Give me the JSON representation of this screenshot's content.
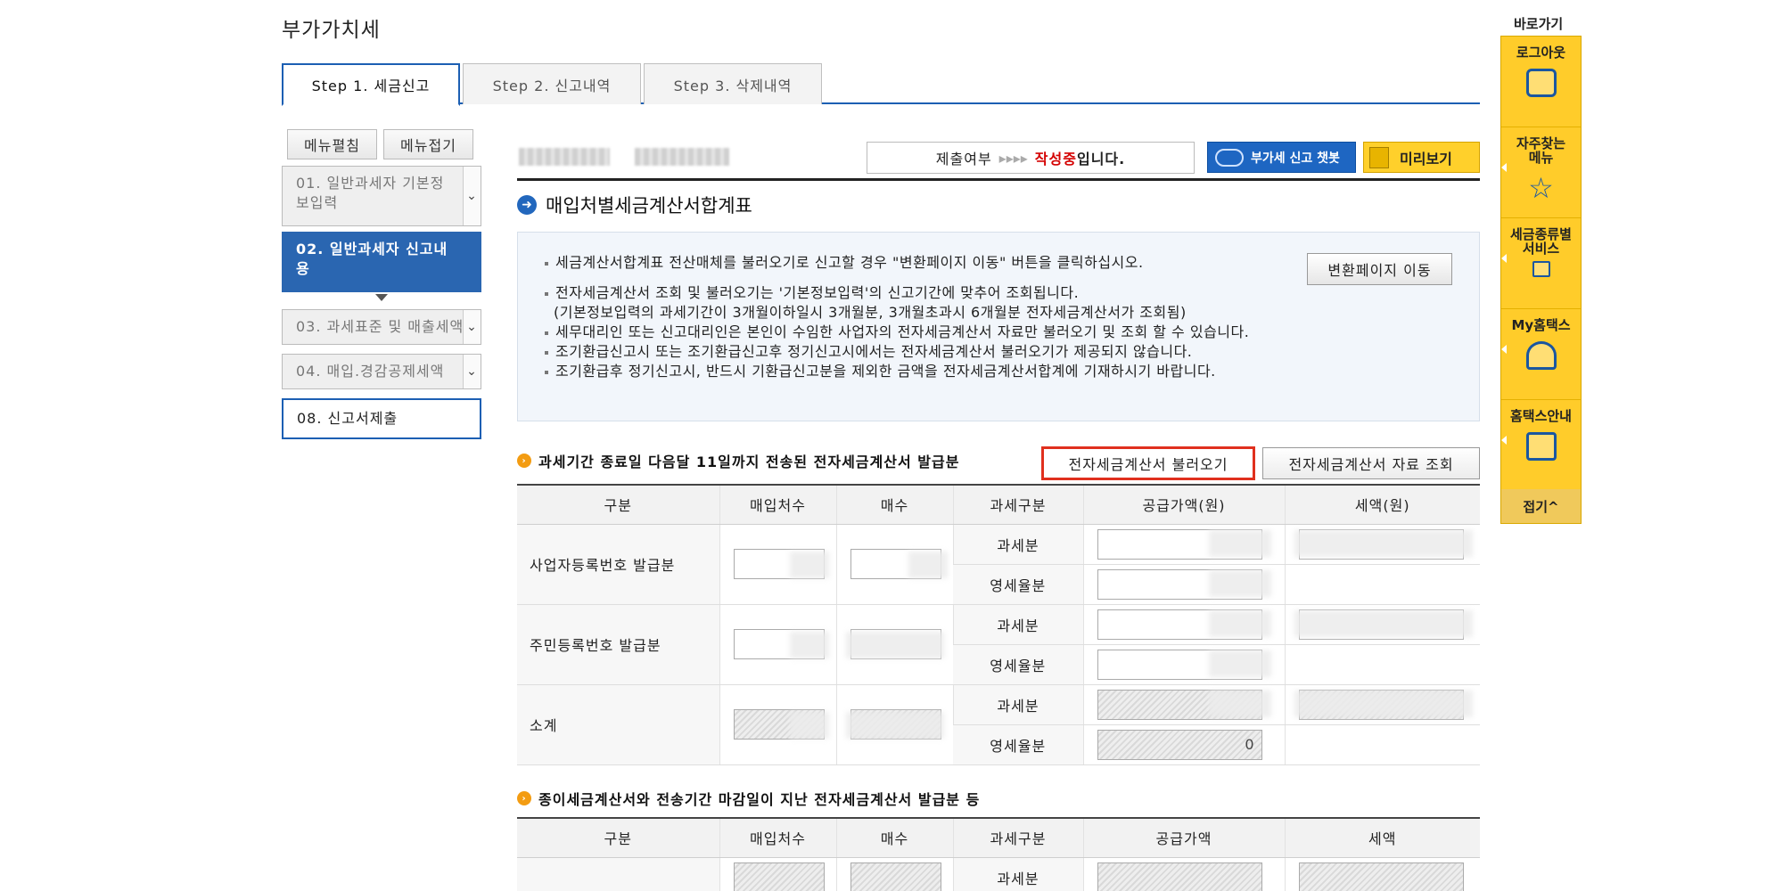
{
  "page_title": "부가가치세",
  "step_tabs": [
    "Step 1. 세금신고",
    "Step 2. 신고내역",
    "Step 3. 삭제내역"
  ],
  "menu_buttons": {
    "expand": "메뉴펼침",
    "collapse": "메뉴접기"
  },
  "left_menu": [
    {
      "label": "01. 일반과세자 기본정보입력"
    },
    {
      "label": "02. 일반과세자 신고내용"
    },
    {
      "label": "03. 과세표준 및 매출세액"
    },
    {
      "label": "04. 매입.경감공제세액"
    },
    {
      "label": "08. 신고서제출"
    }
  ],
  "status": {
    "prefix": "제출여부",
    "arrows": "▸▸▸▸",
    "highlight": "작성중",
    "suffix": "입니다."
  },
  "chatbot_label": "부가세 신고 챗봇",
  "preview_label": "미리보기",
  "section_title": "매입처별세금계산서합계표",
  "info_lines": [
    "세금계산서합계표 전산매체를 불러오기로 신고할 경우 \"변환페이지 이동\" 버튼을 클릭하십시오.",
    "전자세금계산서 조회 및 불러오기는 '기본정보입력'의 신고기간에 맞추어 조회됩니다.",
    "(기본정보입력의 과세기간이 3개월이하일시 3개월분, 3개월초과시 6개월분 전자세금계산서가 조회됨)",
    "세무대리인 또는 신고대리인은 본인이 수임한 사업자의 전자세금계산서 자료만 불러오기 및 조회 할 수 있습니다.",
    "조기환급신고시 또는 조기환급신고후 정기신고시에서는 전자세금계산서 불러오기가 제공되지 않습니다.",
    "조기환급후 정기신고시, 반드시 기환급신고분을 제외한 금액을 전자세금계산서합계에 기재하시기 바랍니다."
  ],
  "convert_button": "변환페이지 이동",
  "sub1_title": "과세기간 종료일 다음달 11일까지 전송된 전자세금계산서 발급분",
  "fetch_button": "전자세금계산서 불러오기",
  "query_button": "전자세금계산서 자료 조회",
  "table1": {
    "headers": [
      "구분",
      "매입처수",
      "매수",
      "과세구분",
      "공급가액(원)",
      "세액(원)"
    ],
    "rows": [
      {
        "label": "사업자등록번호 발급분",
        "cat1": "과세분",
        "cat2": "영세율분"
      },
      {
        "label": "주민등록번호 발급분",
        "cat1": "과세분",
        "cat2": "영세율분"
      },
      {
        "label": "소계",
        "cat1": "과세분",
        "cat2": "영세율분",
        "zero_value": "0"
      }
    ]
  },
  "sub2_title": "종이세금계산서와 전송기간 마감일이 지난 전자세금계산서 발급분 등",
  "table2": {
    "headers": [
      "구분",
      "매입처수",
      "매수",
      "과세구분",
      "공급가액",
      "세액"
    ],
    "first_cat": "과세분"
  },
  "quickbar": {
    "title": "바로가기",
    "items": [
      "로그아웃",
      "자주찾는 메뉴",
      "세금종류별 서비스",
      "My홈택스",
      "홈택스안내"
    ],
    "fold": "접기^"
  }
}
